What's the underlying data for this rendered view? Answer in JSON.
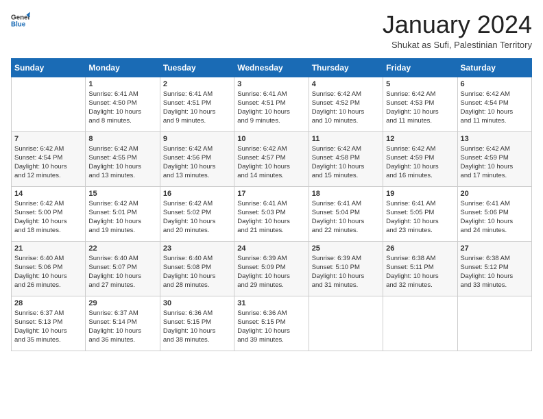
{
  "header": {
    "logo_general": "General",
    "logo_blue": "Blue",
    "title": "January 2024",
    "subtitle": "Shukat as Sufi, Palestinian Territory"
  },
  "weekdays": [
    "Sunday",
    "Monday",
    "Tuesday",
    "Wednesday",
    "Thursday",
    "Friday",
    "Saturday"
  ],
  "weeks": [
    [
      {
        "day": "",
        "info": ""
      },
      {
        "day": "1",
        "info": "Sunrise: 6:41 AM\nSunset: 4:50 PM\nDaylight: 10 hours\nand 8 minutes."
      },
      {
        "day": "2",
        "info": "Sunrise: 6:41 AM\nSunset: 4:51 PM\nDaylight: 10 hours\nand 9 minutes."
      },
      {
        "day": "3",
        "info": "Sunrise: 6:41 AM\nSunset: 4:51 PM\nDaylight: 10 hours\nand 9 minutes."
      },
      {
        "day": "4",
        "info": "Sunrise: 6:42 AM\nSunset: 4:52 PM\nDaylight: 10 hours\nand 10 minutes."
      },
      {
        "day": "5",
        "info": "Sunrise: 6:42 AM\nSunset: 4:53 PM\nDaylight: 10 hours\nand 11 minutes."
      },
      {
        "day": "6",
        "info": "Sunrise: 6:42 AM\nSunset: 4:54 PM\nDaylight: 10 hours\nand 11 minutes."
      }
    ],
    [
      {
        "day": "7",
        "info": "Sunrise: 6:42 AM\nSunset: 4:54 PM\nDaylight: 10 hours\nand 12 minutes."
      },
      {
        "day": "8",
        "info": "Sunrise: 6:42 AM\nSunset: 4:55 PM\nDaylight: 10 hours\nand 13 minutes."
      },
      {
        "day": "9",
        "info": "Sunrise: 6:42 AM\nSunset: 4:56 PM\nDaylight: 10 hours\nand 13 minutes."
      },
      {
        "day": "10",
        "info": "Sunrise: 6:42 AM\nSunset: 4:57 PM\nDaylight: 10 hours\nand 14 minutes."
      },
      {
        "day": "11",
        "info": "Sunrise: 6:42 AM\nSunset: 4:58 PM\nDaylight: 10 hours\nand 15 minutes."
      },
      {
        "day": "12",
        "info": "Sunrise: 6:42 AM\nSunset: 4:59 PM\nDaylight: 10 hours\nand 16 minutes."
      },
      {
        "day": "13",
        "info": "Sunrise: 6:42 AM\nSunset: 4:59 PM\nDaylight: 10 hours\nand 17 minutes."
      }
    ],
    [
      {
        "day": "14",
        "info": "Sunrise: 6:42 AM\nSunset: 5:00 PM\nDaylight: 10 hours\nand 18 minutes."
      },
      {
        "day": "15",
        "info": "Sunrise: 6:42 AM\nSunset: 5:01 PM\nDaylight: 10 hours\nand 19 minutes."
      },
      {
        "day": "16",
        "info": "Sunrise: 6:42 AM\nSunset: 5:02 PM\nDaylight: 10 hours\nand 20 minutes."
      },
      {
        "day": "17",
        "info": "Sunrise: 6:41 AM\nSunset: 5:03 PM\nDaylight: 10 hours\nand 21 minutes."
      },
      {
        "day": "18",
        "info": "Sunrise: 6:41 AM\nSunset: 5:04 PM\nDaylight: 10 hours\nand 22 minutes."
      },
      {
        "day": "19",
        "info": "Sunrise: 6:41 AM\nSunset: 5:05 PM\nDaylight: 10 hours\nand 23 minutes."
      },
      {
        "day": "20",
        "info": "Sunrise: 6:41 AM\nSunset: 5:06 PM\nDaylight: 10 hours\nand 24 minutes."
      }
    ],
    [
      {
        "day": "21",
        "info": "Sunrise: 6:40 AM\nSunset: 5:06 PM\nDaylight: 10 hours\nand 26 minutes."
      },
      {
        "day": "22",
        "info": "Sunrise: 6:40 AM\nSunset: 5:07 PM\nDaylight: 10 hours\nand 27 minutes."
      },
      {
        "day": "23",
        "info": "Sunrise: 6:40 AM\nSunset: 5:08 PM\nDaylight: 10 hours\nand 28 minutes."
      },
      {
        "day": "24",
        "info": "Sunrise: 6:39 AM\nSunset: 5:09 PM\nDaylight: 10 hours\nand 29 minutes."
      },
      {
        "day": "25",
        "info": "Sunrise: 6:39 AM\nSunset: 5:10 PM\nDaylight: 10 hours\nand 31 minutes."
      },
      {
        "day": "26",
        "info": "Sunrise: 6:38 AM\nSunset: 5:11 PM\nDaylight: 10 hours\nand 32 minutes."
      },
      {
        "day": "27",
        "info": "Sunrise: 6:38 AM\nSunset: 5:12 PM\nDaylight: 10 hours\nand 33 minutes."
      }
    ],
    [
      {
        "day": "28",
        "info": "Sunrise: 6:37 AM\nSunset: 5:13 PM\nDaylight: 10 hours\nand 35 minutes."
      },
      {
        "day": "29",
        "info": "Sunrise: 6:37 AM\nSunset: 5:14 PM\nDaylight: 10 hours\nand 36 minutes."
      },
      {
        "day": "30",
        "info": "Sunrise: 6:36 AM\nSunset: 5:15 PM\nDaylight: 10 hours\nand 38 minutes."
      },
      {
        "day": "31",
        "info": "Sunrise: 6:36 AM\nSunset: 5:15 PM\nDaylight: 10 hours\nand 39 minutes."
      },
      {
        "day": "",
        "info": ""
      },
      {
        "day": "",
        "info": ""
      },
      {
        "day": "",
        "info": ""
      }
    ]
  ]
}
